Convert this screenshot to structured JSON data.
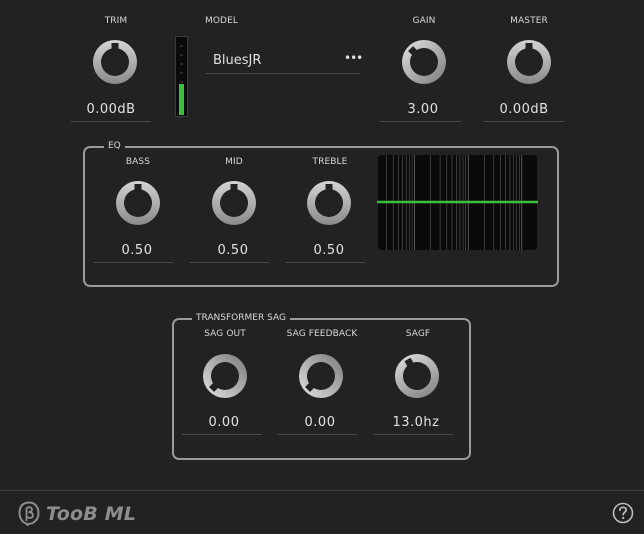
{
  "controls": {
    "trim": {
      "label": "TRIM",
      "value": "0.00dB"
    },
    "gain": {
      "label": "GAIN",
      "value": "3.00"
    },
    "master": {
      "label": "MASTER",
      "value": "0.00dB"
    }
  },
  "model": {
    "label": "MODEL",
    "selected": "BluesJR",
    "more_icon": "more-horizontal-icon",
    "level_meter": 0.4
  },
  "eq": {
    "title": "EQ",
    "bass": {
      "label": "BASS",
      "value": "0.50"
    },
    "mid": {
      "label": "MID",
      "value": "0.50"
    },
    "treble": {
      "label": "TREBLE",
      "value": "0.50"
    }
  },
  "sag": {
    "title": "TRANSFORMER SAG",
    "sag_out": {
      "label": "SAG OUT",
      "value": "0.00"
    },
    "sag_feedback": {
      "label": "SAG FEEDBACK",
      "value": "0.00"
    },
    "sagf": {
      "label": "SAGF",
      "value": "13.0hz"
    }
  },
  "footer": {
    "title": "TooB ML",
    "logo_icon": "toob-logo-icon",
    "help_icon": "help-icon"
  },
  "colors": {
    "background": "#222222",
    "accent_green": "#3cbf3c",
    "border": "#9a9a9a"
  }
}
